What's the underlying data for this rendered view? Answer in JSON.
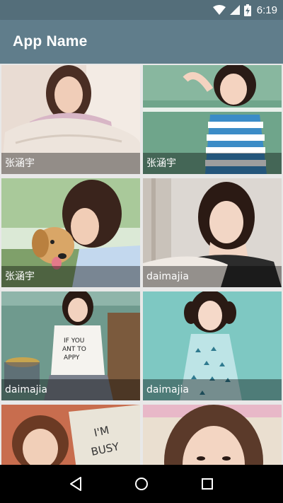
{
  "status_bar": {
    "time": "6:19",
    "icons": [
      "wifi-icon",
      "signal-icon",
      "battery-charging-icon"
    ]
  },
  "app_bar": {
    "title": "App Name",
    "color": "#607d8b"
  },
  "gallery": {
    "items": [
      {
        "caption": "张涵宇",
        "image": "girl-holding-pillow-photo"
      },
      {
        "caption": "张涵宇",
        "image": "girl-striped-tank-top-photo"
      },
      {
        "caption": "张涵宇",
        "image": "girl-with-golden-retriever-photo"
      },
      {
        "caption": "daimajia",
        "image": "girl-hand-on-chin-photo"
      },
      {
        "caption": "daimajia",
        "image": "girl-white-tshirt-sitting-photo"
      },
      {
        "caption": "daimajia",
        "image": "girl-blue-dress-photo"
      },
      {
        "caption": "",
        "image": "girl-busy-bag-photo"
      },
      {
        "caption": "",
        "image": "girl-smiling-closeup-photo"
      }
    ]
  },
  "nav_bar": {
    "buttons": [
      "back-icon",
      "home-icon",
      "recents-icon"
    ]
  }
}
